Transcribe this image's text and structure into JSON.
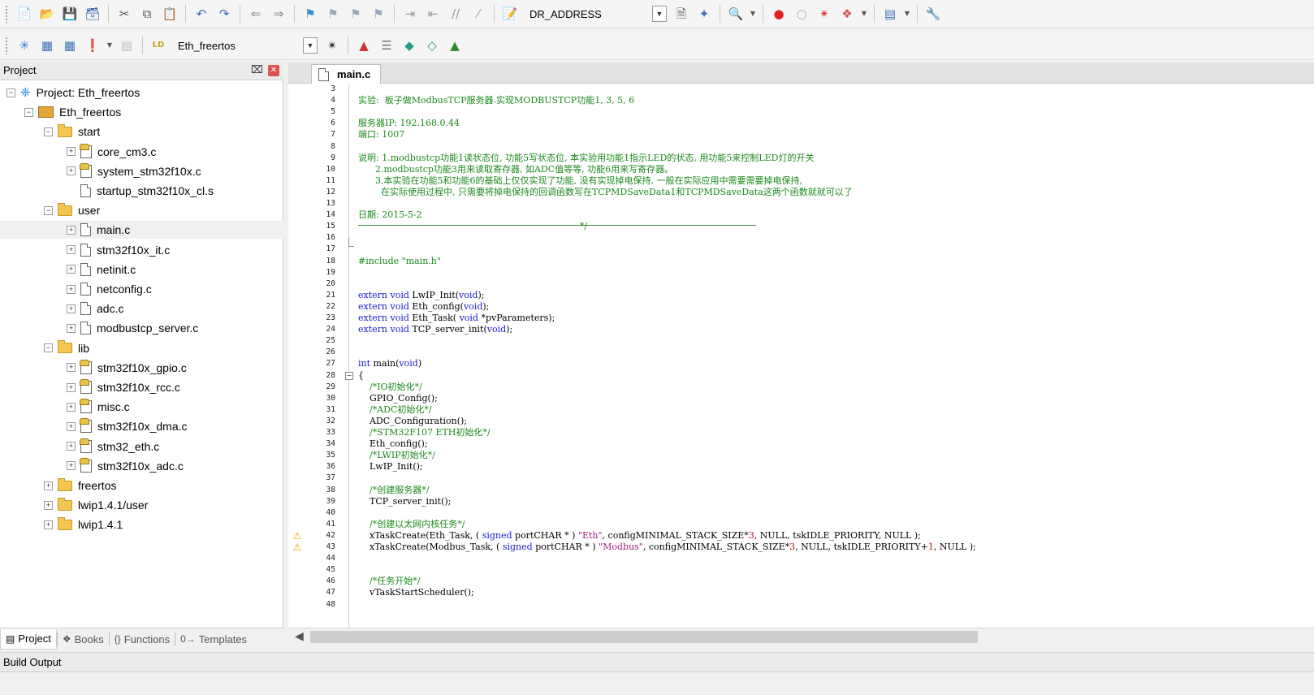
{
  "toolbar1": {
    "target_combo": "DR_ADDRESS",
    "buttons": [
      "new-file",
      "open-file",
      "save-file",
      "save-all",
      "cut",
      "copy",
      "paste",
      "undo",
      "redo",
      "nav-back",
      "nav-forward",
      "bookmark-toggle",
      "bookmark-prev",
      "bookmark-next",
      "bookmark-clear",
      "indent",
      "unindent",
      "comment",
      "uncomment",
      "find-in-files",
      "find",
      "find-replace",
      "debug-session",
      "breakpoint-insert",
      "breakpoint-enable",
      "breakpoint-disable-all",
      "breakpoint-kill-all",
      "window-layout",
      "configure"
    ]
  },
  "toolbar2": {
    "target_combo": "Eth_freertos",
    "buttons": [
      "translate",
      "build",
      "rebuild",
      "batch-build",
      "stop-build",
      "download",
      "target-options",
      "manage-components",
      "select-pack",
      "pack-installer",
      "environment"
    ]
  },
  "project_panel": {
    "title": "Project",
    "pin": " ▮",
    "close": "✕",
    "tree": [
      {
        "label": "Project: Eth_freertos",
        "kind": "project",
        "level": 0,
        "expander": "−"
      },
      {
        "label": "Eth_freertos",
        "kind": "target",
        "level": 1,
        "expander": "−"
      },
      {
        "label": "start",
        "kind": "folder",
        "level": 2,
        "expander": "−"
      },
      {
        "label": "core_cm3.c",
        "kind": "cfile",
        "level": 3,
        "expander": "+"
      },
      {
        "label": "system_stm32f10x.c",
        "kind": "cfile",
        "level": 3,
        "expander": "+"
      },
      {
        "label": "startup_stm32f10x_cl.s",
        "kind": "file",
        "level": 3,
        "expander": ""
      },
      {
        "label": "user",
        "kind": "folder",
        "level": 2,
        "expander": "−"
      },
      {
        "label": "main.c",
        "kind": "file",
        "level": 3,
        "expander": "+",
        "selected": true
      },
      {
        "label": "stm32f10x_it.c",
        "kind": "file",
        "level": 3,
        "expander": "+"
      },
      {
        "label": "netinit.c",
        "kind": "file",
        "level": 3,
        "expander": "+"
      },
      {
        "label": "netconfig.c",
        "kind": "file",
        "level": 3,
        "expander": "+"
      },
      {
        "label": "adc.c",
        "kind": "file",
        "level": 3,
        "expander": "+"
      },
      {
        "label": "modbustcp_server.c",
        "kind": "file",
        "level": 3,
        "expander": "+"
      },
      {
        "label": "lib",
        "kind": "folder",
        "level": 2,
        "expander": "−"
      },
      {
        "label": "stm32f10x_gpio.c",
        "kind": "cfile",
        "level": 3,
        "expander": "+"
      },
      {
        "label": "stm32f10x_rcc.c",
        "kind": "cfile",
        "level": 3,
        "expander": "+"
      },
      {
        "label": "misc.c",
        "kind": "cfile",
        "level": 3,
        "expander": "+"
      },
      {
        "label": "stm32f10x_dma.c",
        "kind": "cfile",
        "level": 3,
        "expander": "+"
      },
      {
        "label": "stm32_eth.c",
        "kind": "cfile",
        "level": 3,
        "expander": "+"
      },
      {
        "label": "stm32f10x_adc.c",
        "kind": "cfile",
        "level": 3,
        "expander": "+"
      },
      {
        "label": "freertos",
        "kind": "folder",
        "level": 2,
        "expander": "+"
      },
      {
        "label": "lwip1.4.1/user",
        "kind": "folder",
        "level": 2,
        "expander": "+"
      },
      {
        "label": "lwip1.4.1",
        "kind": "folder",
        "level": 2,
        "expander": "+"
      }
    ],
    "tabs": [
      {
        "label": "Project",
        "icon": "▤",
        "active": true
      },
      {
        "label": "Books",
        "icon": "❖",
        "active": false
      },
      {
        "label": "Functions",
        "icon": "{}",
        "active": false
      },
      {
        "label": "Templates",
        "icon": "0→",
        "active": false
      }
    ]
  },
  "editor": {
    "tab_label": "main.c",
    "line_numbers": [
      "3",
      "4",
      "5",
      "6",
      "7",
      "8",
      "9",
      "10",
      "11",
      "12",
      "13",
      "14",
      "15",
      "16",
      "17",
      "18",
      "19",
      "20",
      "21",
      "22",
      "23",
      "24",
      "25",
      "26",
      "27",
      "28",
      "29",
      "30",
      "31",
      "32",
      "33",
      "34",
      "35",
      "36",
      "37",
      "38",
      "39",
      "40",
      "41",
      "42",
      "43",
      "44",
      "45",
      "46",
      "47",
      "48"
    ],
    "lines": [
      {
        "n": 4,
        "segs": [
          [
            "cm",
            "实验:  板子做ModbusTCP服务器.实现MODBUSTCP功能1, 3, 5, 6"
          ]
        ]
      },
      {
        "n": 6,
        "segs": [
          [
            "cm",
            "服务器IP: 192.168.0.44"
          ]
        ]
      },
      {
        "n": 7,
        "segs": [
          [
            "cm",
            "端口: 1007"
          ]
        ]
      },
      {
        "n": 9,
        "segs": [
          [
            "cm",
            "说明: 1.modbustcp功能1读状态位, 功能5写状态位, 本实验用功能1指示LED的状态, 用功能5来控制LED灯的开关"
          ]
        ]
      },
      {
        "n": 10,
        "segs": [
          [
            "cm",
            "      2.modbustcp功能3用来读取寄存器, 如ADC值等等, 功能6用来写寄存器。"
          ]
        ]
      },
      {
        "n": 11,
        "segs": [
          [
            "cm",
            "      3.本实验在功能5和功能6的基础上仅仅实现了功能, 没有实现掉电保持, 一般在实际应用中需要需要掉电保持,"
          ]
        ]
      },
      {
        "n": 12,
        "segs": [
          [
            "cm",
            "        在实际使用过程中, 只需要将掉电保持的回调函数写在TCPMDSaveData1和TCPMDSaveData这两个函数就就可以了"
          ]
        ]
      },
      {
        "n": 14,
        "segs": [
          [
            "cm",
            "日期: 2015-5-2"
          ]
        ]
      },
      {
        "n": 15,
        "segs": [
          [
            "cm",
            "                                                                              */"
          ]
        ]
      },
      {
        "n": 18,
        "segs": [
          [
            "cm",
            "#include \"main.h\""
          ]
        ]
      },
      {
        "n": 21,
        "segs": [
          [
            "kw",
            "extern void "
          ],
          [
            "",
            "LwIP_Init("
          ],
          [
            "kw",
            "void"
          ],
          [
            "",
            ");"
          ]
        ]
      },
      {
        "n": 22,
        "segs": [
          [
            "kw",
            "extern void "
          ],
          [
            "",
            "Eth_config("
          ],
          [
            "kw",
            "void"
          ],
          [
            "",
            ");"
          ]
        ]
      },
      {
        "n": 23,
        "segs": [
          [
            "kw",
            "extern void "
          ],
          [
            "",
            "Eth_Task( "
          ],
          [
            "kw",
            "void "
          ],
          [
            "",
            "*pvParameters);"
          ]
        ]
      },
      {
        "n": 24,
        "segs": [
          [
            "kw",
            "extern void "
          ],
          [
            "",
            "TCP_server_init("
          ],
          [
            "kw",
            "void"
          ],
          [
            "",
            ");"
          ]
        ]
      },
      {
        "n": 27,
        "segs": [
          [
            "kw",
            "int "
          ],
          [
            "",
            "main("
          ],
          [
            "kw",
            "void"
          ],
          [
            "",
            ")"
          ]
        ]
      },
      {
        "n": 28,
        "segs": [
          [
            "",
            "{"
          ]
        ]
      },
      {
        "n": 29,
        "segs": [
          [
            "cm",
            "    /*IO初始化*/"
          ]
        ]
      },
      {
        "n": 30,
        "segs": [
          [
            "",
            "    GPIO_Config();"
          ]
        ]
      },
      {
        "n": 31,
        "segs": [
          [
            "cm",
            "    /*ADC初始化*/"
          ]
        ]
      },
      {
        "n": 32,
        "segs": [
          [
            "",
            "    ADC_Configuration();"
          ]
        ]
      },
      {
        "n": 33,
        "segs": [
          [
            "cm",
            "    /*STM32F107 ETH初始化*/"
          ]
        ]
      },
      {
        "n": 34,
        "segs": [
          [
            "",
            "    Eth_config();"
          ]
        ]
      },
      {
        "n": 35,
        "segs": [
          [
            "cm",
            "    /*LWIP初始化*/"
          ]
        ]
      },
      {
        "n": 36,
        "segs": [
          [
            "",
            "    LwIP_Init();"
          ]
        ]
      },
      {
        "n": 38,
        "segs": [
          [
            "cm",
            "    /*创建服务器*/"
          ]
        ]
      },
      {
        "n": 39,
        "segs": [
          [
            "",
            "    TCP_server_init();"
          ]
        ]
      },
      {
        "n": 41,
        "segs": [
          [
            "cm",
            "    /*创建以太网内核任务*/"
          ]
        ]
      },
      {
        "n": 42,
        "segs": [
          [
            "",
            "    xTaskCreate(Eth_Task, ( "
          ],
          [
            "kw",
            "signed "
          ],
          [
            "",
            "portCHAR * ) "
          ],
          [
            "str",
            "\"Eth\""
          ],
          [
            "",
            ", configMINIMAL_STACK_SIZE*"
          ],
          [
            "num",
            "3"
          ],
          [
            "",
            ", NULL, tskIDLE_PRIORITY, NULL );"
          ]
        ]
      },
      {
        "n": 43,
        "segs": [
          [
            "",
            "    xTaskCreate(Modbus_Task, ( "
          ],
          [
            "kw",
            "signed "
          ],
          [
            "",
            "portCHAR * ) "
          ],
          [
            "str",
            "\"Modbus\""
          ],
          [
            "",
            ", configMINIMAL_STACK_SIZE*"
          ],
          [
            "num",
            "3"
          ],
          [
            "",
            ", NULL, tskIDLE_PRIORITY+"
          ],
          [
            "num",
            "1"
          ],
          [
            "",
            ", NULL );"
          ]
        ]
      },
      {
        "n": 46,
        "segs": [
          [
            "cm",
            "    /*任务开始*/"
          ]
        ]
      },
      {
        "n": 47,
        "segs": [
          [
            "",
            "    vTaskStartScheduler();"
          ]
        ]
      }
    ],
    "warnings_on_lines": [
      42,
      43
    ],
    "fold_on_line": 28
  },
  "build_output": {
    "title": "Build Output"
  }
}
